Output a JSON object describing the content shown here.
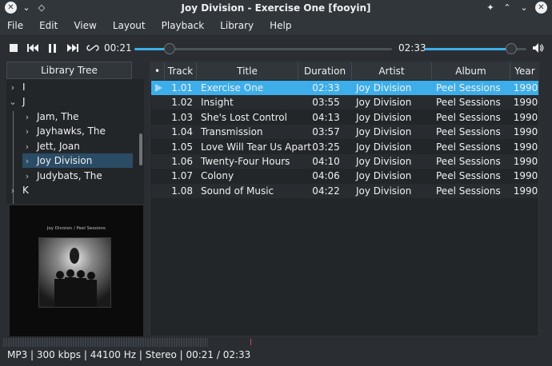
{
  "window": {
    "title": "Joy Division - Exercise One [fooyin]"
  },
  "menu": [
    "File",
    "Edit",
    "View",
    "Layout",
    "Playback",
    "Library",
    "Help"
  ],
  "player": {
    "elapsed": "00:21",
    "total": "02:33",
    "progress": 0.137,
    "volume": 0.85
  },
  "library": {
    "header": "Library Tree",
    "nodes": [
      {
        "label": "I",
        "expanded": false
      },
      {
        "label": "J",
        "expanded": true
      },
      {
        "label": "Jam, The",
        "expanded": false
      },
      {
        "label": "Jayhawks, The",
        "expanded": false
      },
      {
        "label": "Jett, Joan",
        "expanded": false
      },
      {
        "label": "Joy Division",
        "expanded": false,
        "selected": true
      },
      {
        "label": "Judybats, The",
        "expanded": false
      },
      {
        "label": "K",
        "expanded": false
      }
    ]
  },
  "artwork": {
    "caption": "Joy Division / Peel Sessions"
  },
  "playlist": {
    "columns": [
      "•",
      "Track",
      "Title",
      "Duration",
      "Artist",
      "Album",
      "Year"
    ],
    "rows": [
      {
        "track": "1.01",
        "title": "Exercise One",
        "duration": "02:33",
        "artist": "Joy Division",
        "album": "Peel Sessions",
        "year": "1990",
        "playing": true
      },
      {
        "track": "1.02",
        "title": "Insight",
        "duration": "03:55",
        "artist": "Joy Division",
        "album": "Peel Sessions",
        "year": "1990"
      },
      {
        "track": "1.03",
        "title": "She's Lost Control",
        "duration": "04:13",
        "artist": "Joy Division",
        "album": "Peel Sessions",
        "year": "1990"
      },
      {
        "track": "1.04",
        "title": "Transmission",
        "duration": "03:57",
        "artist": "Joy Division",
        "album": "Peel Sessions",
        "year": "1990"
      },
      {
        "track": "1.05",
        "title": "Love Will Tear Us Apart",
        "duration": "03:25",
        "artist": "Joy Division",
        "album": "Peel Sessions",
        "year": "1990"
      },
      {
        "track": "1.06",
        "title": "Twenty-Four Hours",
        "duration": "04:10",
        "artist": "Joy Division",
        "album": "Peel Sessions",
        "year": "1990"
      },
      {
        "track": "1.07",
        "title": "Colony",
        "duration": "04:06",
        "artist": "Joy Division",
        "album": "Peel Sessions",
        "year": "1990"
      },
      {
        "track": "1.08",
        "title": "Sound of Music",
        "duration": "04:22",
        "artist": "Joy Division",
        "album": "Peel Sessions",
        "year": "1990"
      }
    ]
  },
  "status": {
    "text": "MP3 | 300 kbps | 44100 Hz | Stereo | 00:21 / 02:33"
  },
  "icons": {
    "close": "close-icon",
    "chevron": "chevron-down-icon",
    "pin": "pin-icon",
    "stop": "stop-icon",
    "prev": "previous-icon",
    "pause": "pause-icon",
    "next": "next-icon",
    "repeat": "repeat-icon",
    "volume": "volume-icon"
  },
  "colors": {
    "accent": "#3daee9",
    "selection": "#2b4c65",
    "background": "#2a2e32"
  }
}
